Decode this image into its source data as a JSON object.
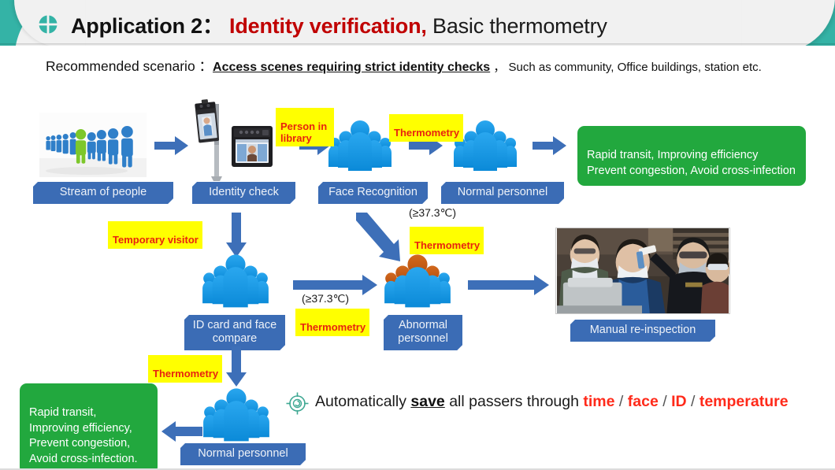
{
  "header": {
    "title_main": "Application 2",
    "title_colon": "：",
    "title_red": "Identity verification,",
    "title_rest": " Basic thermometry",
    "bullet_icon": "circle-cross-icon",
    "accent_color": "#34b3a6",
    "red_color": "#c00000",
    "bar_color": "#f1f1f1"
  },
  "subtitle": {
    "lead": "Recommended scenario ：",
    "emphasis": "Access scenes requiring strict identity checks",
    "tail": " ， Such as community, Office buildings, station etc."
  },
  "flow": {
    "labels": {
      "stream_of_people": "Stream of people",
      "identity_check": "Identity check",
      "face_recognition": "Face Recognition",
      "normal_personnel_top": "Normal personnel",
      "id_card_and_face_compare": "ID card and\nface compare",
      "abnormal_personnel": "Abnormal\npersonnel",
      "manual_reinspection": "Manual re-inspection",
      "normal_personnel_bottom": "Normal personnel"
    },
    "tags": {
      "person_in_library": "Person in\nlibrary",
      "thermometry_top": "Thermometry",
      "temporary_visitor": "Temporary visitor",
      "thermometry_mid_right": "Thermometry",
      "thermometry_mid_left": "Thermometry",
      "thermometry_bottom": "Thermometry"
    },
    "temp_notes": {
      "upper": "(≥37.3℃)",
      "lower": "(≥37.3℃)"
    },
    "outcomes": {
      "top_green": "Rapid transit, Improving efficiency\nPrevent congestion, Avoid cross-infection",
      "bottom_green": "Rapid transit,\nImproving efficiency,\nPrevent congestion,\nAvoid cross-infection."
    },
    "colors": {
      "label_blue": "#3b6cb5",
      "arrow_blue": "#3d6fb8",
      "green": "#22a83e",
      "tag_yellow": "#ffff00",
      "tag_text_red": "#e8230f",
      "people_blue": "#1b9ae8",
      "people_abnormal": "#c9561a"
    }
  },
  "bottom_note": {
    "icon": "target-crosshair-icon",
    "prefix": "Automatically ",
    "save_word": "save",
    "middle": " all passers through ",
    "items": [
      "time",
      "face",
      "ID",
      "temperature"
    ],
    "separator": " / "
  },
  "images": {
    "crowd": "stream-of-people-photo",
    "device_terminal": "face-recognition-terminal-photo",
    "device_tablet": "face-recognition-tablet-photo",
    "inspection": "manual-temperature-inspection-photo"
  }
}
